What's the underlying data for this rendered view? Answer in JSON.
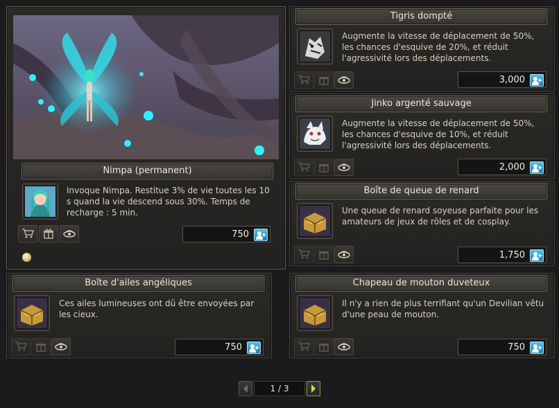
{
  "featured": {
    "title": "Nimpa (permanent)",
    "description": "Invoque Nimpa. Restitue 3% de vie toutes les 10 s quand la vie descend sous 30%. Temps de recharge : 5 min.",
    "price": "750",
    "icon": "fairy-portrait-icon"
  },
  "items": [
    {
      "title": "Tigris dompté",
      "description": "Augmente la vitesse de déplacement de 50%, les chances d'esquive de 20%, et réduit l'agressivité lors des déplacements.",
      "price": "3,000",
      "icon": "tiger-mount-icon"
    },
    {
      "title": "Jinko argenté sauvage",
      "description": "Augmente la vitesse de déplacement de 50%, les chances d'esquive de 10%, et réduit l'agressivité lors des déplacements.",
      "price": "2,000",
      "icon": "white-beast-mount-icon"
    },
    {
      "title": "Boîte de queue de renard",
      "description": "Une queue de renard soyeuse parfaite pour les amateurs de jeux de rôles et de cosplay.",
      "price": "1,750",
      "icon": "treasure-box-icon"
    },
    {
      "title": "Boîte d'ailes angéliques",
      "description": "Ces ailes lumineuses ont dû être envoyées par les cieux.",
      "price": "750",
      "icon": "treasure-box-icon"
    },
    {
      "title": "Chapeau de mouton duveteux",
      "description": "Il n'y a rien de plus terrifiant qu'un Devilian vêtu d'une peau de mouton.",
      "price": "750",
      "icon": "treasure-box-icon"
    }
  ],
  "pagination": {
    "label": "1 / 3"
  },
  "colors": {
    "currency": "#2f9fd4",
    "next_arrow": "#c7e23a"
  }
}
